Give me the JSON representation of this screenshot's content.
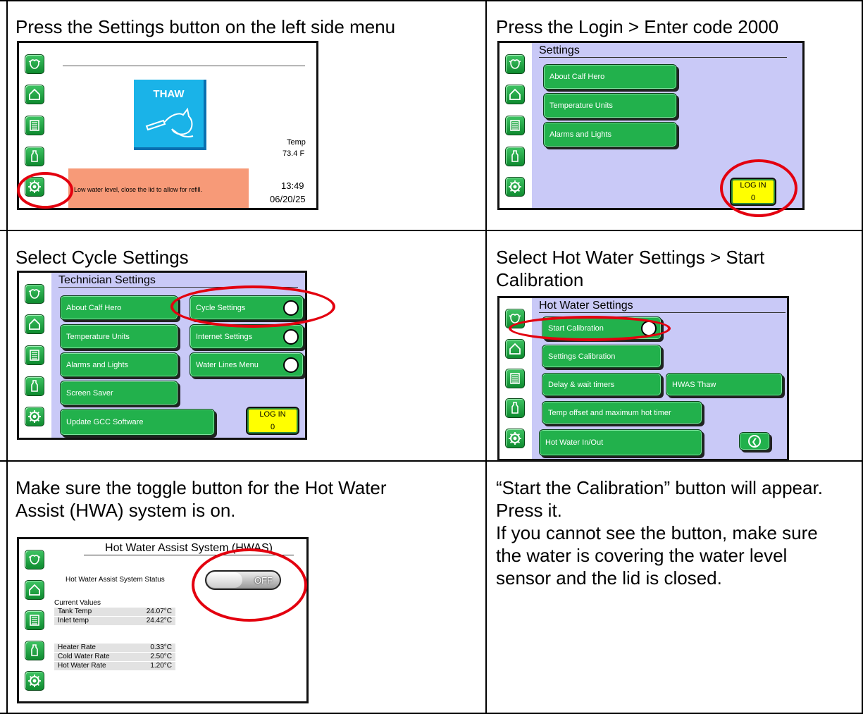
{
  "captions": {
    "c1": "Press the Settings button on the left side menu",
    "c2": "Press the Login > Enter code 2000",
    "c3": "Select Cycle Settings",
    "c4": [
      "Select Hot Water Settings > Start",
      "Calibration"
    ],
    "c5": [
      "Make sure the toggle button for the Hot Water",
      "Assist (HWA) system is on."
    ],
    "c6": [
      "“Start the Calibration” button will appear.",
      "Press it.",
      "If you cannot see the button, make sure",
      "the water is covering the water level",
      "sensor and the lid is closed."
    ]
  },
  "colors": {
    "accent": "#e3000f",
    "button_green": "#22b14c",
    "login_yellow": "#ffff00",
    "panel_lavender": "#c9c9f7",
    "alert_salmon": "#f79a78",
    "thaw_blue": "#1ab3e8"
  },
  "sidebar_icons": [
    "cow-icon",
    "home-icon",
    "list-icon",
    "bottle-icon",
    "settings-icon"
  ],
  "screen1": {
    "thaw_label": "THAW",
    "temp_label": "Temp",
    "temp_value": "73.4 F",
    "alert": "Low water level, close the lid to allow for refill.",
    "time": "13:49",
    "date": "06/20/25"
  },
  "screen2": {
    "title": "Settings",
    "buttons": [
      "About Calf Hero",
      "Temperature Units",
      "Alarms and Lights"
    ],
    "login_label": "LOG IN",
    "login_value": "0"
  },
  "screen3": {
    "title": "Technician Settings",
    "left": [
      "About Calf Hero",
      "Temperature Units",
      "Alarms and Lights",
      "Screen Saver",
      "Update GCC Software"
    ],
    "right": [
      "Cycle Settings",
      "Internet Settings",
      "Water Lines Menu"
    ],
    "login_label": "LOG IN",
    "login_value": "0"
  },
  "screen4": {
    "title": "Hot Water Settings",
    "buttons": [
      "Start Calibration",
      "Settings Calibration",
      "Delay & wait timers",
      "HWAS Thaw",
      "Temp offset and maximum hot timer",
      "Hot Water In/Out"
    ]
  },
  "screen5": {
    "title": "Hot Water Assist System (HWAS)",
    "status_label": "Hot Water Assist System Status",
    "toggle": "OFF",
    "current_values": "Current Values",
    "rows": [
      {
        "label": "Tank Temp",
        "value": "24.07°C"
      },
      {
        "label": "Inlet temp",
        "value": "24.42°C"
      },
      {
        "label": "Heater Rate",
        "value": "0.33°C"
      },
      {
        "label": "Cold Water Rate",
        "value": "2.50°C"
      },
      {
        "label": "Hot Water Rate",
        "value": "1.20°C"
      }
    ]
  }
}
